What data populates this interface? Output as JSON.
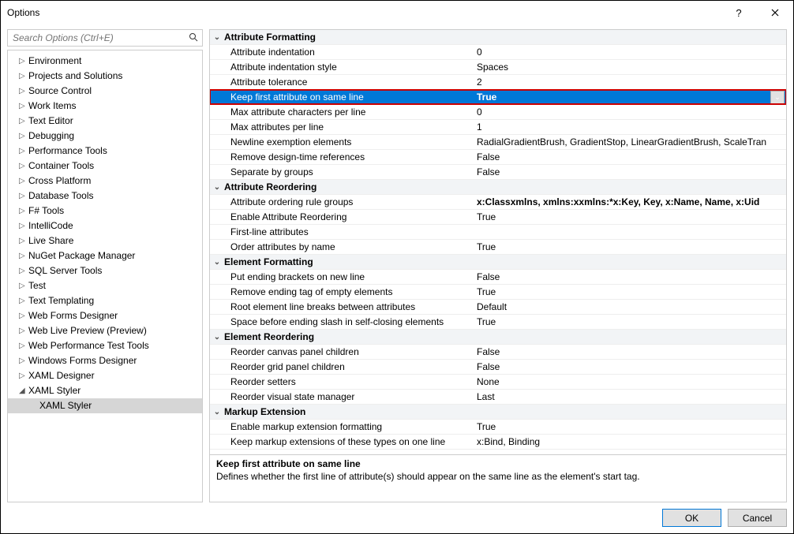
{
  "title": "Options",
  "search": {
    "placeholder": "Search Options (Ctrl+E)"
  },
  "tree": [
    {
      "label": "Environment",
      "expanded": false
    },
    {
      "label": "Projects and Solutions",
      "expanded": false
    },
    {
      "label": "Source Control",
      "expanded": false
    },
    {
      "label": "Work Items",
      "expanded": false
    },
    {
      "label": "Text Editor",
      "expanded": false
    },
    {
      "label": "Debugging",
      "expanded": false
    },
    {
      "label": "Performance Tools",
      "expanded": false
    },
    {
      "label": "Container Tools",
      "expanded": false
    },
    {
      "label": "Cross Platform",
      "expanded": false
    },
    {
      "label": "Database Tools",
      "expanded": false
    },
    {
      "label": "F# Tools",
      "expanded": false
    },
    {
      "label": "IntelliCode",
      "expanded": false
    },
    {
      "label": "Live Share",
      "expanded": false
    },
    {
      "label": "NuGet Package Manager",
      "expanded": false
    },
    {
      "label": "SQL Server Tools",
      "expanded": false
    },
    {
      "label": "Test",
      "expanded": false
    },
    {
      "label": "Text Templating",
      "expanded": false
    },
    {
      "label": "Web Forms Designer",
      "expanded": false
    },
    {
      "label": "Web Live Preview (Preview)",
      "expanded": false
    },
    {
      "label": "Web Performance Test Tools",
      "expanded": false
    },
    {
      "label": "Windows Forms Designer",
      "expanded": false
    },
    {
      "label": "XAML Designer",
      "expanded": false
    },
    {
      "label": "XAML Styler",
      "expanded": true,
      "children": [
        {
          "label": "XAML Styler",
          "selected": true
        }
      ]
    }
  ],
  "grid": [
    {
      "type": "category",
      "label": "Attribute Formatting"
    },
    {
      "type": "prop",
      "label": "Attribute indentation",
      "value": "0"
    },
    {
      "type": "prop",
      "label": "Attribute indentation style",
      "value": "Spaces"
    },
    {
      "type": "prop",
      "label": "Attribute tolerance",
      "value": "2"
    },
    {
      "type": "prop",
      "label": "Keep first attribute on same line",
      "value": "True",
      "highlighted": true,
      "dropdown": true,
      "bold": true
    },
    {
      "type": "prop",
      "label": "Max attribute characters per line",
      "value": "0"
    },
    {
      "type": "prop",
      "label": "Max attributes per line",
      "value": "1"
    },
    {
      "type": "prop",
      "label": "Newline exemption elements",
      "value": "RadialGradientBrush, GradientStop, LinearGradientBrush, ScaleTran"
    },
    {
      "type": "prop",
      "label": "Remove design-time references",
      "value": "False"
    },
    {
      "type": "prop",
      "label": "Separate by groups",
      "value": "False"
    },
    {
      "type": "category",
      "label": "Attribute Reordering"
    },
    {
      "type": "prop",
      "label": "Attribute ordering rule groups",
      "value": "x:Classxmlns, xmlns:xxmlns:*x:Key, Key, x:Name, Name, x:Uid",
      "bold": true
    },
    {
      "type": "prop",
      "label": "Enable Attribute Reordering",
      "value": "True"
    },
    {
      "type": "prop",
      "label": "First-line attributes",
      "value": ""
    },
    {
      "type": "prop",
      "label": "Order attributes by name",
      "value": "True"
    },
    {
      "type": "category",
      "label": "Element Formatting"
    },
    {
      "type": "prop",
      "label": "Put ending brackets on new line",
      "value": "False"
    },
    {
      "type": "prop",
      "label": "Remove ending tag of empty elements",
      "value": "True"
    },
    {
      "type": "prop",
      "label": "Root element line breaks between attributes",
      "value": "Default"
    },
    {
      "type": "prop",
      "label": "Space before ending slash in self-closing elements",
      "value": "True"
    },
    {
      "type": "category",
      "label": "Element Reordering"
    },
    {
      "type": "prop",
      "label": "Reorder canvas panel children",
      "value": "False"
    },
    {
      "type": "prop",
      "label": "Reorder grid panel children",
      "value": "False"
    },
    {
      "type": "prop",
      "label": "Reorder setters",
      "value": "None"
    },
    {
      "type": "prop",
      "label": "Reorder visual state manager",
      "value": "Last"
    },
    {
      "type": "category",
      "label": "Markup Extension"
    },
    {
      "type": "prop",
      "label": "Enable markup extension formatting",
      "value": "True"
    },
    {
      "type": "prop",
      "label": "Keep markup extensions of these types on one line",
      "value": "x:Bind, Binding"
    }
  ],
  "description": {
    "title": "Keep first attribute on same line",
    "text": "Defines whether the first line of attribute(s) should appear on the same line as the element's start tag."
  },
  "buttons": {
    "ok": "OK",
    "cancel": "Cancel"
  }
}
